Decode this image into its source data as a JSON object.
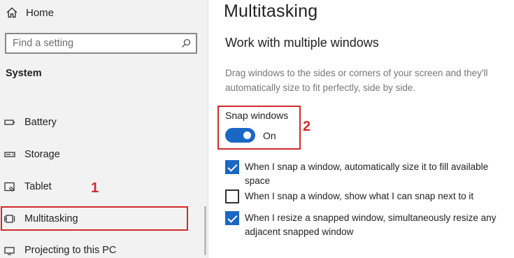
{
  "sidebar": {
    "home_label": "Home",
    "search_placeholder": "Find a setting",
    "section_title": "System",
    "items": [
      {
        "label": "Battery",
        "icon": "battery-icon"
      },
      {
        "label": "Storage",
        "icon": "storage-icon"
      },
      {
        "label": "Tablet",
        "icon": "tablet-icon"
      },
      {
        "label": "Multitasking",
        "icon": "multitasking-icon",
        "selected": true
      },
      {
        "label": "Projecting to this PC",
        "icon": "projecting-icon"
      }
    ]
  },
  "annotations": {
    "step1": "1",
    "step2": "2",
    "color": "#d12a2a"
  },
  "main": {
    "title": "Multitasking",
    "subheading": "Work with multiple windows",
    "description": "Drag windows to the sides or corners of your screen and they'll automatically size to fit perfectly, side by side.",
    "snap": {
      "label": "Snap windows",
      "state": "On",
      "on": true
    },
    "options": [
      {
        "text": "When I snap a window, automatically size it to fill available space",
        "checked": true
      },
      {
        "text": "When I snap a window, show what I can snap next to it",
        "checked": false
      },
      {
        "text": "When I resize a snapped window, simultaneously resize any adjacent snapped window",
        "checked": true
      }
    ]
  },
  "colors": {
    "accent": "#1a67c4",
    "sidebar_bg": "#f2f2f2"
  }
}
